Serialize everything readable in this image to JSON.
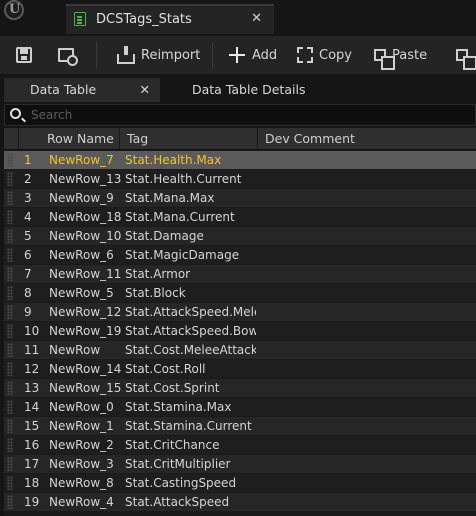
{
  "window": {
    "logo_icon": "unreal-engine-logo",
    "tab_title": "DCSTags_Stats",
    "tab_icon": "data-table-icon",
    "tab_close": "✕"
  },
  "toolbar": {
    "save_icon": "save-icon",
    "browse_icon": "browse-icon",
    "reimport_label": "Reimport",
    "add_label": "Add",
    "copy_label": "Copy",
    "paste_label": "Paste"
  },
  "panels": {
    "data_table_tab": "Data Table",
    "data_table_close": "✕",
    "details_tab": "Data Table Details"
  },
  "search": {
    "placeholder": "Search",
    "value": ""
  },
  "table": {
    "columns": [
      "Row Name",
      "Tag",
      "Dev Comment"
    ],
    "selected_index": 0,
    "rows": [
      {
        "index": "1",
        "name": "NewRow_7",
        "tag": "Stat.Health.Max",
        "dev": ""
      },
      {
        "index": "2",
        "name": "NewRow_13",
        "tag": "Stat.Health.Current",
        "dev": ""
      },
      {
        "index": "3",
        "name": "NewRow_9",
        "tag": "Stat.Mana.Max",
        "dev": ""
      },
      {
        "index": "4",
        "name": "NewRow_18",
        "tag": "Stat.Mana.Current",
        "dev": ""
      },
      {
        "index": "5",
        "name": "NewRow_10",
        "tag": "Stat.Damage",
        "dev": ""
      },
      {
        "index": "6",
        "name": "NewRow_6",
        "tag": "Stat.MagicDamage",
        "dev": ""
      },
      {
        "index": "7",
        "name": "NewRow_11",
        "tag": "Stat.Armor",
        "dev": ""
      },
      {
        "index": "8",
        "name": "NewRow_5",
        "tag": "Stat.Block",
        "dev": ""
      },
      {
        "index": "9",
        "name": "NewRow_12",
        "tag": "Stat.AttackSpeed.Melee",
        "dev": ""
      },
      {
        "index": "10",
        "name": "NewRow_19",
        "tag": "Stat.AttackSpeed.Bow",
        "dev": ""
      },
      {
        "index": "11",
        "name": "NewRow",
        "tag": "Stat.Cost.MeleeAttack",
        "dev": ""
      },
      {
        "index": "12",
        "name": "NewRow_14",
        "tag": "Stat.Cost.Roll",
        "dev": ""
      },
      {
        "index": "13",
        "name": "NewRow_15",
        "tag": "Stat.Cost.Sprint",
        "dev": ""
      },
      {
        "index": "14",
        "name": "NewRow_0",
        "tag": "Stat.Stamina.Max",
        "dev": ""
      },
      {
        "index": "15",
        "name": "NewRow_1",
        "tag": "Stat.Stamina.Current",
        "dev": ""
      },
      {
        "index": "16",
        "name": "NewRow_2",
        "tag": "Stat.CritChance",
        "dev": ""
      },
      {
        "index": "17",
        "name": "NewRow_3",
        "tag": "Stat.CritMultiplier",
        "dev": ""
      },
      {
        "index": "18",
        "name": "NewRow_8",
        "tag": "Stat.CastingSpeed",
        "dev": ""
      },
      {
        "index": "19",
        "name": "NewRow_4",
        "tag": "Stat.AttackSpeed",
        "dev": ""
      }
    ]
  },
  "colors": {
    "selected_text": "#f7c21a",
    "tab_icon_accent": "#4caf50"
  }
}
